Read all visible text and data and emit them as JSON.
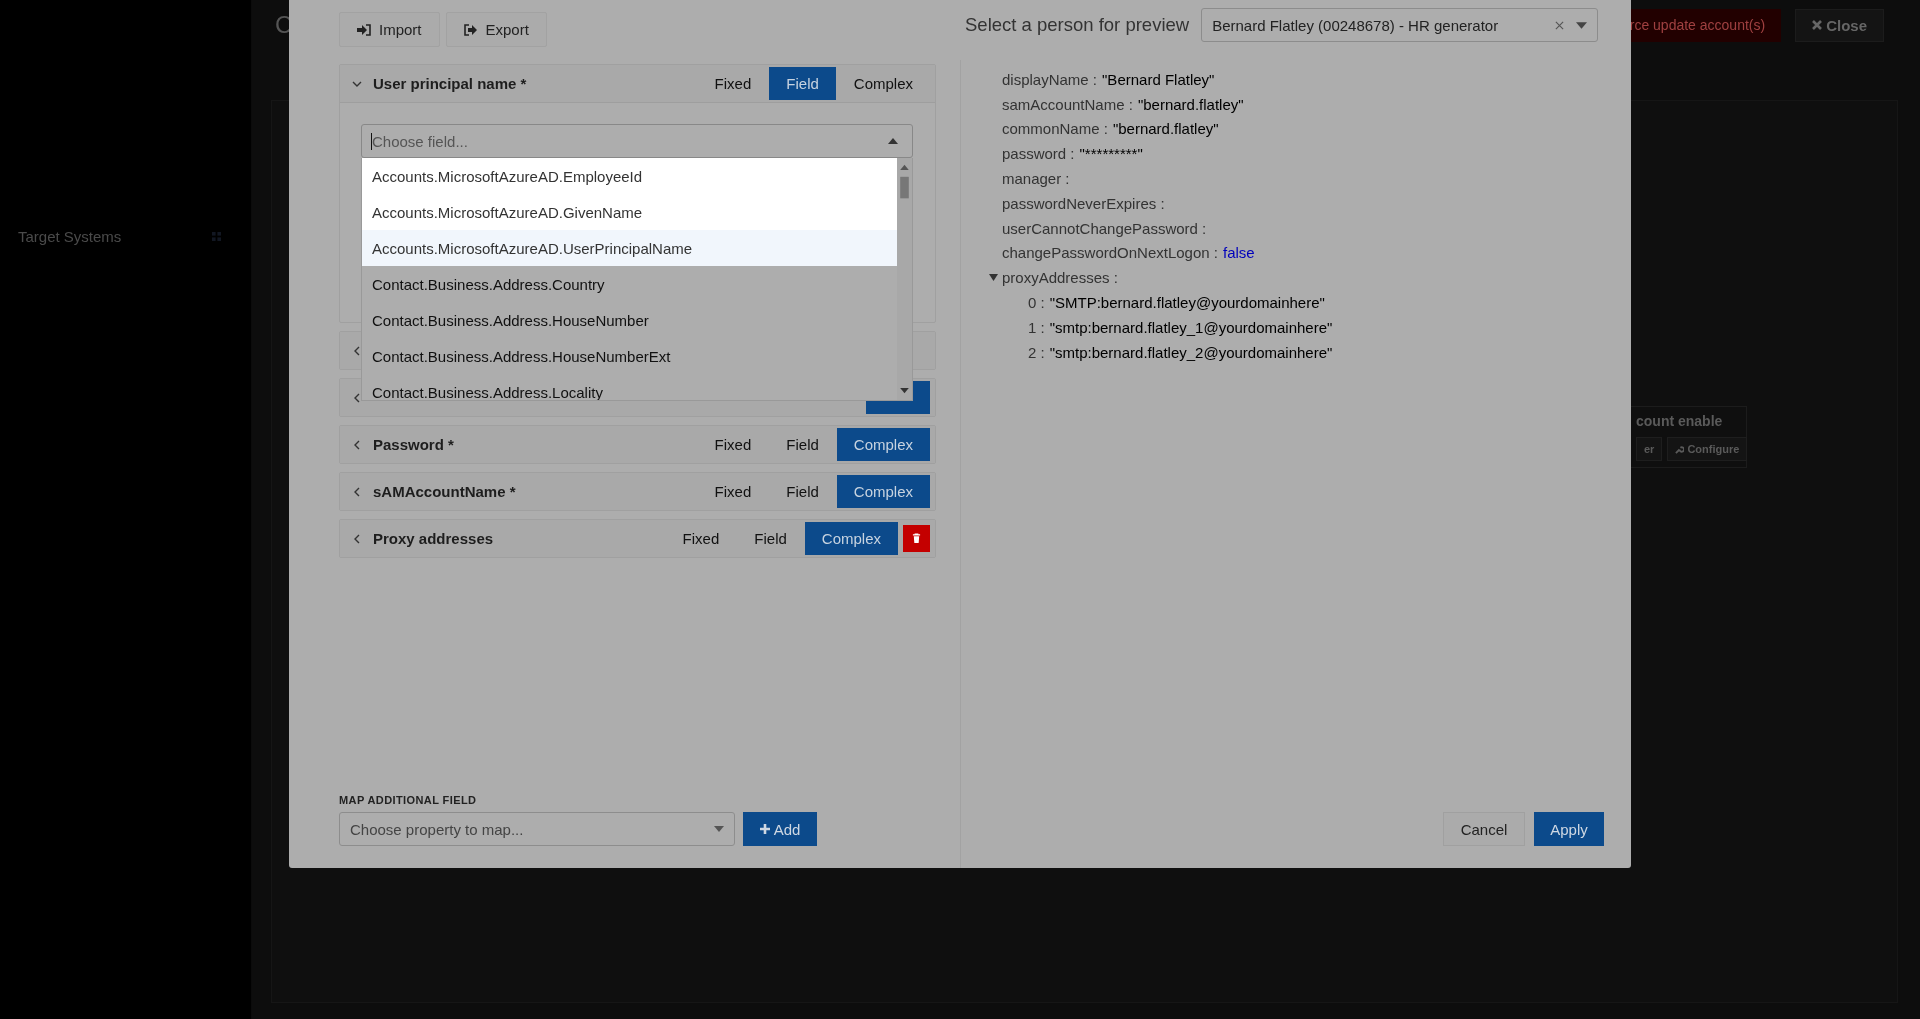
{
  "background": {
    "sidebar": {
      "label": "Target Systems"
    },
    "title": "C",
    "force_button": "rce update account(s)",
    "close_button": "Close",
    "card": {
      "title": "count enable",
      "buttons": [
        "er",
        "Configure"
      ]
    }
  },
  "modal": {
    "toolbar": [
      "Import",
      "Export"
    ],
    "mappings": [
      {
        "title": "User principal name *",
        "expanded": true,
        "modes": [
          {
            "label": "Fixed",
            "selected": false
          },
          {
            "label": "Field",
            "selected": true
          },
          {
            "label": "Complex",
            "selected": false
          }
        ],
        "deletable": false,
        "field": {
          "placeholder": "Choose field...",
          "open": true,
          "options": [
            {
              "label": "Accounts.MicrosoftAzureAD.EmployeeId",
              "dimmed": false,
              "selected": false
            },
            {
              "label": "Accounts.MicrosoftAzureAD.GivenName",
              "dimmed": false,
              "selected": false
            },
            {
              "label": "Accounts.MicrosoftAzureAD.UserPrincipalName",
              "dimmed": false,
              "selected": true
            },
            {
              "label": "Contact.Business.Address.Country",
              "dimmed": true,
              "selected": false
            },
            {
              "label": "Contact.Business.Address.HouseNumber",
              "dimmed": true,
              "selected": false
            },
            {
              "label": "Contact.Business.Address.HouseNumberExt",
              "dimmed": true,
              "selected": false
            },
            {
              "label": "Contact.Business.Address.Locality",
              "dimmed": true,
              "selected": false
            }
          ]
        }
      },
      {
        "expanded": false
      },
      {
        "expanded": false,
        "modes": [
          {
            "selected": true
          }
        ]
      },
      {
        "title": "Password *",
        "expanded": false,
        "modes": [
          {
            "label": "Fixed",
            "selected": false
          },
          {
            "label": "Field",
            "selected": false
          },
          {
            "label": "Complex",
            "selected": true
          }
        ],
        "deletable": false
      },
      {
        "title": "sAMAccountName *",
        "expanded": false,
        "modes": [
          {
            "label": "Fixed",
            "selected": false
          },
          {
            "label": "Field",
            "selected": false
          },
          {
            "label": "Complex",
            "selected": true
          }
        ],
        "deletable": false
      },
      {
        "title": "Proxy addresses",
        "expanded": false,
        "modes": [
          {
            "label": "Fixed",
            "selected": false
          },
          {
            "label": "Field",
            "selected": false
          },
          {
            "label": "Complex",
            "selected": true
          }
        ],
        "deletable": true
      }
    ],
    "additional": {
      "label": "MAP ADDITIONAL FIELD",
      "placeholder": "Choose property to map...",
      "add_button": "Add"
    },
    "preview": {
      "label": "Select a person for preview",
      "person": "Bernard Flatley (00248678) - HR generator",
      "lines": [
        {
          "key": "displayName :",
          "kind": "string",
          "value": "\"Bernard Flatley\""
        },
        {
          "key": "samAccountName :",
          "kind": "string",
          "value": "\"bernard.flatley\""
        },
        {
          "key": "commonName :",
          "kind": "string",
          "value": "\"bernard.flatley\""
        },
        {
          "key": "password :",
          "kind": "string",
          "value": "\"*********\""
        },
        {
          "key": "manager :",
          "kind": "empty"
        },
        {
          "key": "passwordNeverExpires :",
          "kind": "empty"
        },
        {
          "key": "userCannotChangePassword :",
          "kind": "empty"
        },
        {
          "key": "changePasswordOnNextLogon :",
          "kind": "boolean",
          "value": "false"
        },
        {
          "key": "proxyAddresses :",
          "kind": "array",
          "expanded": true,
          "children": [
            {
              "index": "0 :",
              "value": "\"SMTP:bernard.flatley@yourdomainhere\""
            },
            {
              "index": "1 :",
              "value": "\"smtp:bernard.flatley_1@yourdomainhere\""
            },
            {
              "index": "2 :",
              "value": "\"smtp:bernard.flatley_2@yourdomainhere\""
            }
          ]
        }
      ]
    },
    "buttons": [
      "Cancel",
      "Apply"
    ]
  }
}
